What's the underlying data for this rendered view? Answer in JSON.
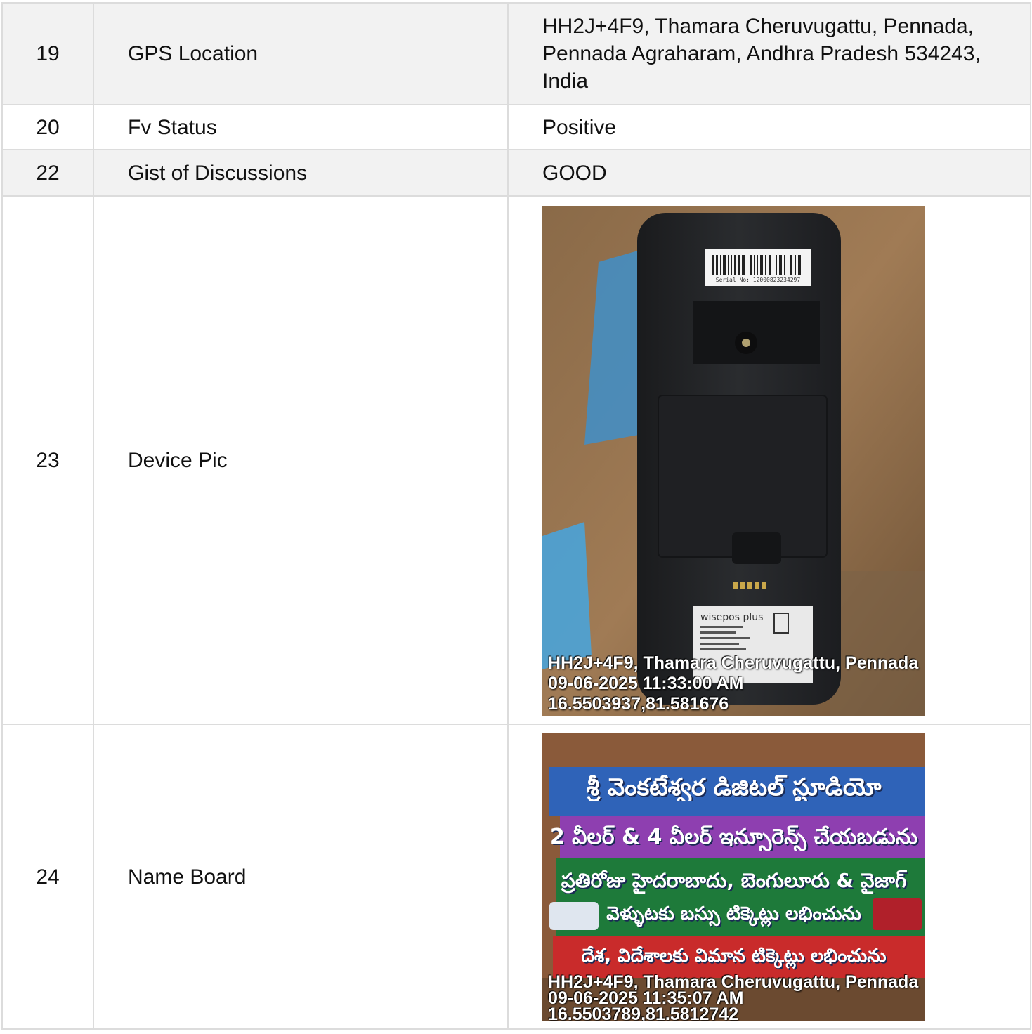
{
  "rows": [
    {
      "num": "19",
      "label": "GPS Location",
      "value": "HH2J+4F9, Thamara Cheruvugattu, Pennada, Pennada Agraharam, Andhra Pradesh 534243, India"
    },
    {
      "num": "20",
      "label": "Fv Status",
      "value": "Positive"
    },
    {
      "num": "22",
      "label": "Gist of Discussions",
      "value": "GOOD"
    },
    {
      "num": "23",
      "label": "Device Pic"
    },
    {
      "num": "24",
      "label": "Name Board"
    }
  ],
  "device_photo": {
    "serial_label": "Serial No: 12000823234297",
    "brand": "wisepos plus",
    "stamp_address": "HH2J+4F9, Thamara Cheruvugattu, Pennada",
    "stamp_datetime": "09-06-2025 11:33:00 AM",
    "stamp_coords": "16.5503937,81.581676"
  },
  "board_photo": {
    "line1": "శ్రీ వెంకటేశ్వర డిజిటల్ స్టూడియో",
    "line2": "2 వీలర్ & 4 వీలర్ ఇన్సూరెన్స్ చేయబడును",
    "line3": "ప్రతిరోజు హైదరాబాదు, బెంగులూరు & వైజాగ్",
    "line4": "వెళ్ళుటకు బస్సు టిక్కెట్లు లభించును",
    "line5": "దేశ, విదేశాలకు విమాన టిక్కెట్లు లభించును",
    "stamp_address": "HH2J+4F9, Thamara Cheruvugattu, Pennada",
    "stamp_datetime": "09-06-2025 11:35:07 AM",
    "stamp_coords": "16.5503789,81.5812742"
  }
}
